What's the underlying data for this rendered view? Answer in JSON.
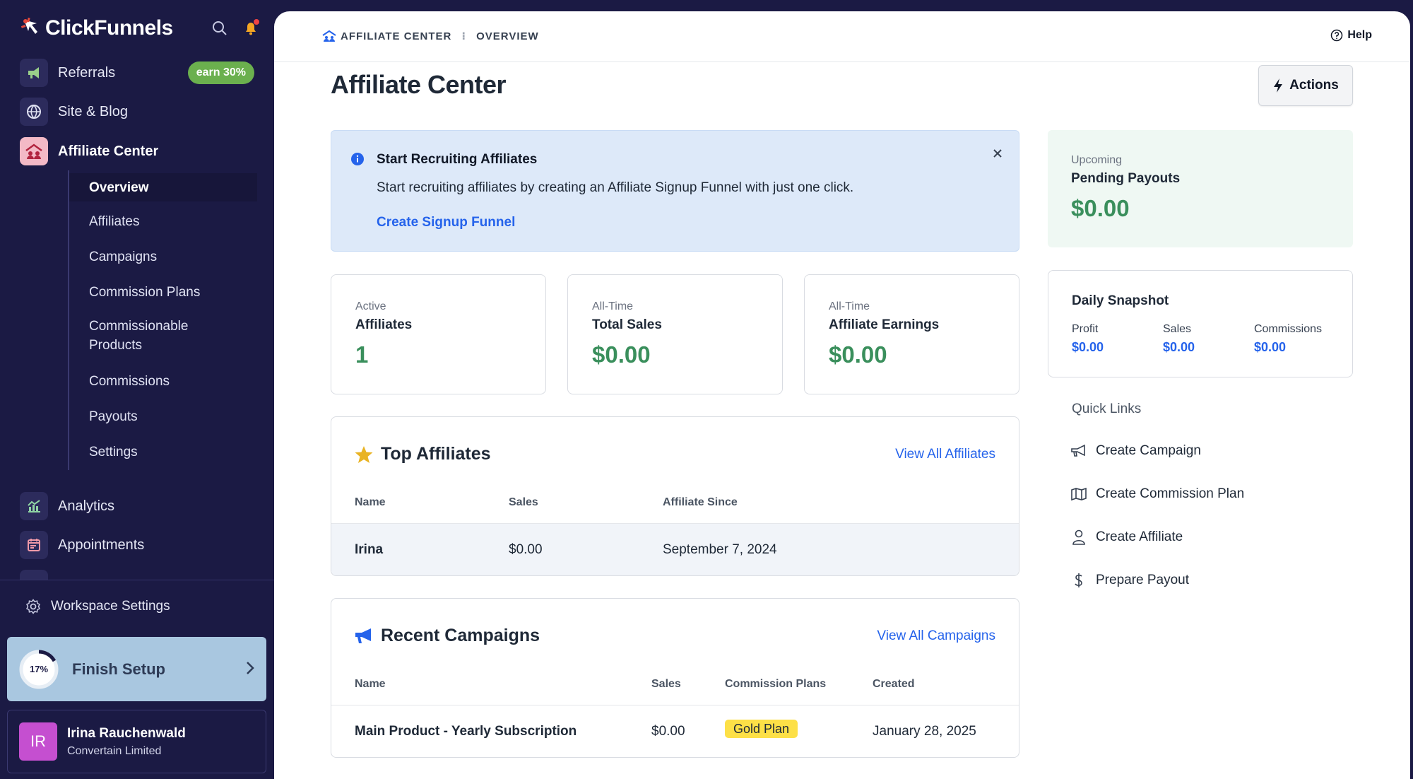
{
  "app": {
    "name": "ClickFunnels"
  },
  "sidebar": {
    "items": [
      {
        "label": "Referrals",
        "badge": "earn 30%"
      },
      {
        "label": "Site & Blog"
      },
      {
        "label": "Affiliate Center"
      },
      {
        "label": "Analytics"
      },
      {
        "label": "Appointments"
      }
    ],
    "subitems": [
      "Overview",
      "Affiliates",
      "Campaigns",
      "Commission Plans",
      "Commissionable Products",
      "Commissions",
      "Payouts",
      "Settings"
    ],
    "workspace_settings": "Workspace Settings",
    "finish_setup": {
      "label": "Finish Setup",
      "progress": "17%",
      "fraction": 0.17
    },
    "user": {
      "initials": "IR",
      "name": "Irina Rauchenwald",
      "org": "Convertain Limited"
    }
  },
  "breadcrumb": {
    "section": "AFFILIATE CENTER",
    "page": "OVERVIEW"
  },
  "header": {
    "help": "Help",
    "title": "Affiliate Center",
    "actions": "Actions"
  },
  "alert": {
    "title": "Start Recruiting Affiliates",
    "body": "Start recruiting affiliates by creating an Affiliate Signup Funnel with just one click.",
    "link": "Create Signup Funnel"
  },
  "payouts": {
    "caption": "Upcoming",
    "label": "Pending Payouts",
    "value": "$0.00"
  },
  "stats": [
    {
      "caption": "Active",
      "label": "Affiliates",
      "value": "1"
    },
    {
      "caption": "All-Time",
      "label": "Total Sales",
      "value": "$0.00"
    },
    {
      "caption": "All-Time",
      "label": "Affiliate Earnings",
      "value": "$0.00"
    }
  ],
  "snapshot": {
    "title": "Daily Snapshot",
    "cols": [
      {
        "k": "Profit",
        "v": "$0.00"
      },
      {
        "k": "Sales",
        "v": "$0.00"
      },
      {
        "k": "Commissions",
        "v": "$0.00"
      }
    ]
  },
  "quick_links": {
    "title": "Quick Links",
    "items": [
      "Create Campaign",
      "Create Commission Plan",
      "Create Affiliate",
      "Prepare Payout"
    ]
  },
  "top_affiliates": {
    "title": "Top Affiliates",
    "link": "View All Affiliates",
    "headers": [
      "Name",
      "Sales",
      "Affiliate Since"
    ],
    "rows": [
      {
        "name": "Irina",
        "sales": "$0.00",
        "since": "September 7, 2024"
      }
    ]
  },
  "recent_campaigns": {
    "title": "Recent Campaigns",
    "link": "View All Campaigns",
    "headers": [
      "Name",
      "Sales",
      "Commission Plans",
      "Created"
    ],
    "rows": [
      {
        "name": "Main Product - Yearly Subscription",
        "sales": "$0.00",
        "plan": "Gold Plan",
        "created": "January 28, 2025"
      }
    ]
  },
  "colors": {
    "brand_dark": "#1b1a44",
    "accent_blue": "#2563eb",
    "money_green": "#3a8f5c",
    "badge_green": "#6bb04e",
    "pill_yellow": "#fde047"
  }
}
